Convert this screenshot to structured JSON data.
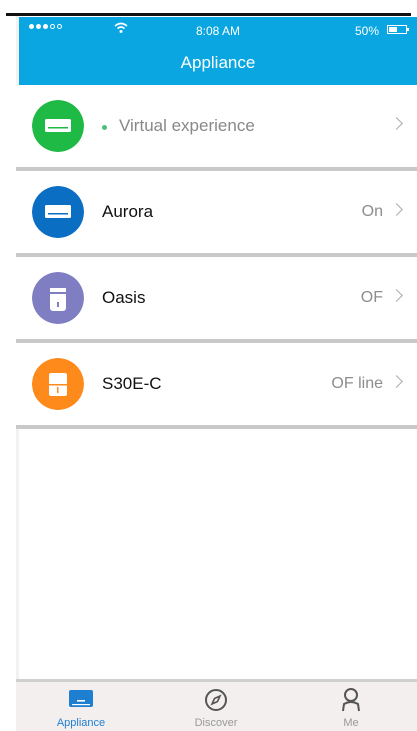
{
  "status_bar": {
    "time": "8:08 AM",
    "battery_percent": "50%",
    "battery_level": 0.5
  },
  "header": {
    "title": "Appliance"
  },
  "appliances": [
    {
      "name": "Virtual experience",
      "status": "",
      "icon": "air-conditioner-icon",
      "color": "#1fb945"
    },
    {
      "name": "Aurora",
      "status": "On",
      "icon": "air-conditioner-icon",
      "color": "#0a6fc2"
    },
    {
      "name": "Oasis",
      "status": "OF",
      "icon": "air-purifier-icon",
      "color": "#7f7ec3"
    },
    {
      "name": "S30E-C",
      "status": "OF line",
      "icon": "dehumidifier-icon",
      "color": "#ff8a1c"
    }
  ],
  "tabs": [
    {
      "label": "Appliance",
      "icon": "appliance-icon",
      "active": true
    },
    {
      "label": "Discover",
      "icon": "compass-icon",
      "active": false
    },
    {
      "label": "Me",
      "icon": "person-icon",
      "active": false
    }
  ],
  "colors": {
    "accent": "#0aa6e2",
    "tab_active": "#1e7fd0"
  }
}
